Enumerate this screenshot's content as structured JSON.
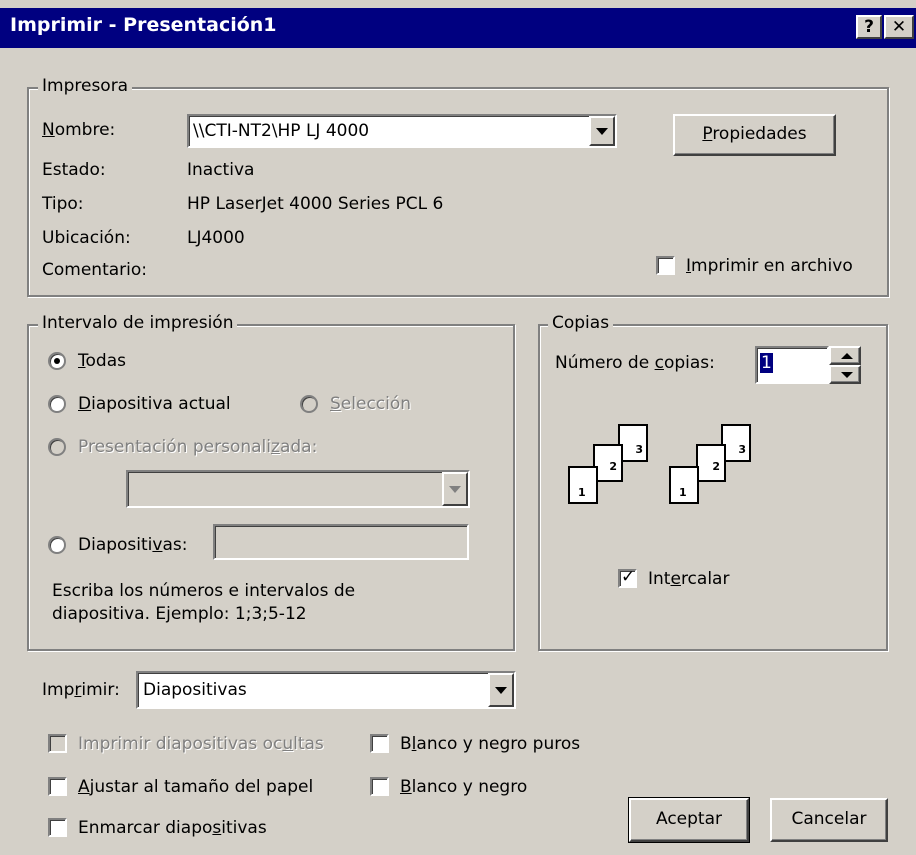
{
  "window": {
    "title": "Imprimir - Presentación1",
    "help_btn": "?",
    "close_btn": "✕"
  },
  "printer": {
    "group_label": "Impresora",
    "name_label_u": "N",
    "name_label_rest": "ombre:",
    "name_value": "\\\\CTI-NT2\\HP LJ 4000",
    "properties_u": "P",
    "properties_rest": "ropiedades",
    "status_label": "Estado:",
    "status_value": "Inactiva",
    "type_label": "Tipo:",
    "type_value": "HP LaserJet 4000 Series PCL 6",
    "location_label": "Ubicación:",
    "location_value": "LJ4000",
    "comment_label": "Comentario:",
    "print_to_file_u": "I",
    "print_to_file_rest": "mprimir en archivo"
  },
  "range": {
    "group_label": "Intervalo de impresión",
    "all_u": "T",
    "all_rest": "odas",
    "current_u": "D",
    "current_rest": "iapositiva actual",
    "selection_u": "S",
    "selection_rest": "elección",
    "custom_pre": "Presentación personali",
    "custom_u": "z",
    "custom_post": "ada:",
    "slides_pre": "Diapositi",
    "slides_u": "v",
    "slides_post": "as:",
    "hint_line1": "Escriba los números e intervalos de",
    "hint_line2": "diapositiva. Ejemplo: 1;3;5-12"
  },
  "copies": {
    "group_label": "Copias",
    "count_pre": "Número de ",
    "count_u": "c",
    "count_post": "opias:",
    "count_value": "1",
    "collate_pre": "Int",
    "collate_u": "e",
    "collate_post": "rcalar",
    "page_nums": [
      "1",
      "2",
      "3"
    ]
  },
  "print_what": {
    "label_pre": "Imp",
    "label_u": "r",
    "label_post": "imir:",
    "value": "Diapositivas"
  },
  "options": {
    "hidden_pre": "Imprimir diapositivas oc",
    "hidden_u": "u",
    "hidden_post": "ltas",
    "pure_bw_pre": "B",
    "pure_bw_u": "l",
    "pure_bw_post": "anco y negro puros",
    "fit_u": "A",
    "fit_rest": "justar al tamaño del papel",
    "bw_u": "B",
    "bw_rest": "lanco y negro",
    "frame_pre": "Enmarcar diapo",
    "frame_u": "s",
    "frame_post": "itivas"
  },
  "buttons": {
    "ok": "Aceptar",
    "cancel": "Cancelar"
  }
}
